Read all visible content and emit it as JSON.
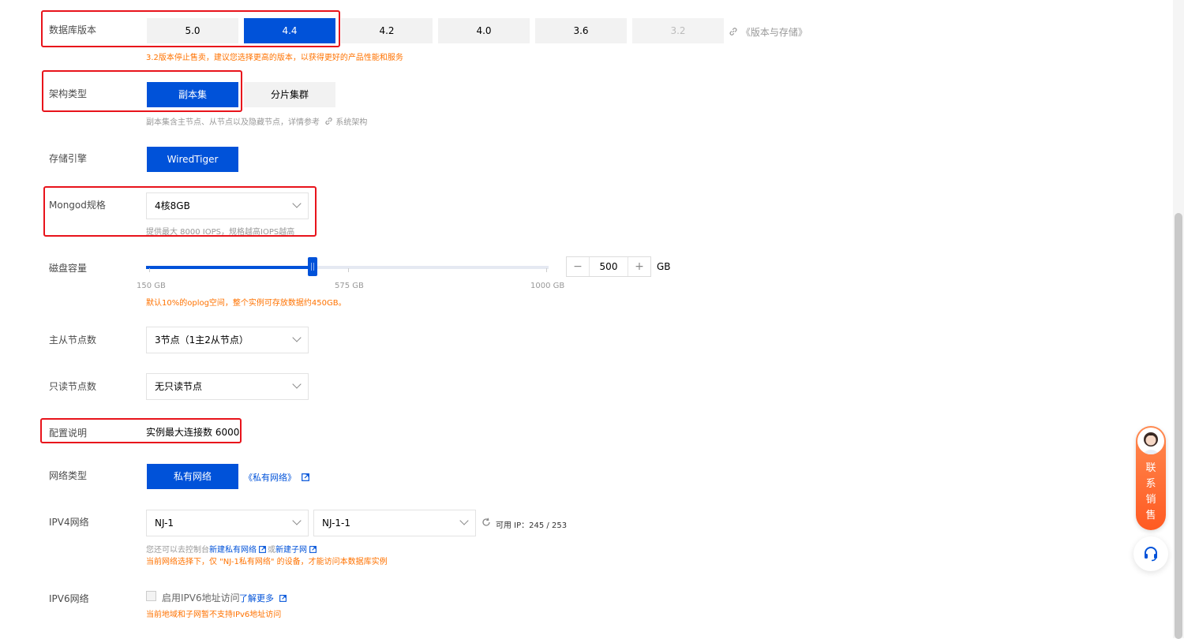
{
  "version": {
    "label": "数据库版本",
    "options": [
      "5.0",
      "4.4",
      "4.2",
      "4.0",
      "3.6",
      "3.2"
    ],
    "selected": "4.4",
    "disabled": "3.2",
    "doc_link": "《版本与存储》",
    "warning": "3.2版本停止售卖，建议您选择更高的版本，以获得更好的产品性能和服务"
  },
  "arch": {
    "label": "架构类型",
    "options": [
      "副本集",
      "分片集群"
    ],
    "selected": "副本集",
    "hint_text": "副本集含主节点、从节点以及隐藏节点，详情参考",
    "hint_link": "系统架构"
  },
  "engine": {
    "label": "存储引擎",
    "value": "WiredTiger"
  },
  "spec": {
    "label": "Mongod规格",
    "value": "4核8GB",
    "hint": "提供最大 8000 IOPS，规格越高IOPS越高"
  },
  "disk": {
    "label": "磁盘容量",
    "min_label": "150 GB",
    "mid_label": "575 GB",
    "max_label": "1000 GB",
    "min": 150,
    "max": 1000,
    "value": 500,
    "value_text": "500",
    "unit": "GB",
    "minus": "−",
    "plus": "+",
    "warning": "默认10%的oplog空间，整个实例可存放数据约450GB。"
  },
  "nodes": {
    "label": "主从节点数",
    "value": "3节点（1主2从节点）"
  },
  "readonly": {
    "label": "只读节点数",
    "value": "无只读节点"
  },
  "config": {
    "label": "配置说明",
    "value": "实例最大连接数 6000"
  },
  "network_type": {
    "label": "网络类型",
    "value": "私有网络",
    "link": "《私有网络》"
  },
  "ipv4": {
    "label": "IPV4网络",
    "vpc": "NJ-1",
    "subnet": "NJ-1-1",
    "available": "可用 IP：245 / 253",
    "hint_prefix": "您还可以去控制台",
    "hint_link1": "新建私有网络",
    "hint_or": "或",
    "hint_link2": "新建子网",
    "warning": "当前网络选择下，仅 \"NJ-1私有网络\" 的设备，才能访问本数据库实例"
  },
  "ipv6": {
    "label": "IPV6网络",
    "checkbox_label": "启用IPV6地址访问",
    "link": "了解更多",
    "warning": "当前地域和子网暂不支持IPv6地址访问"
  },
  "float": {
    "contact_chars": [
      "联",
      "系",
      "销",
      "售"
    ],
    "accent": "#ff6a2b"
  },
  "colors": {
    "primary": "#0052d9",
    "warning": "#ff7200",
    "highlight_box": "#e8131b"
  }
}
